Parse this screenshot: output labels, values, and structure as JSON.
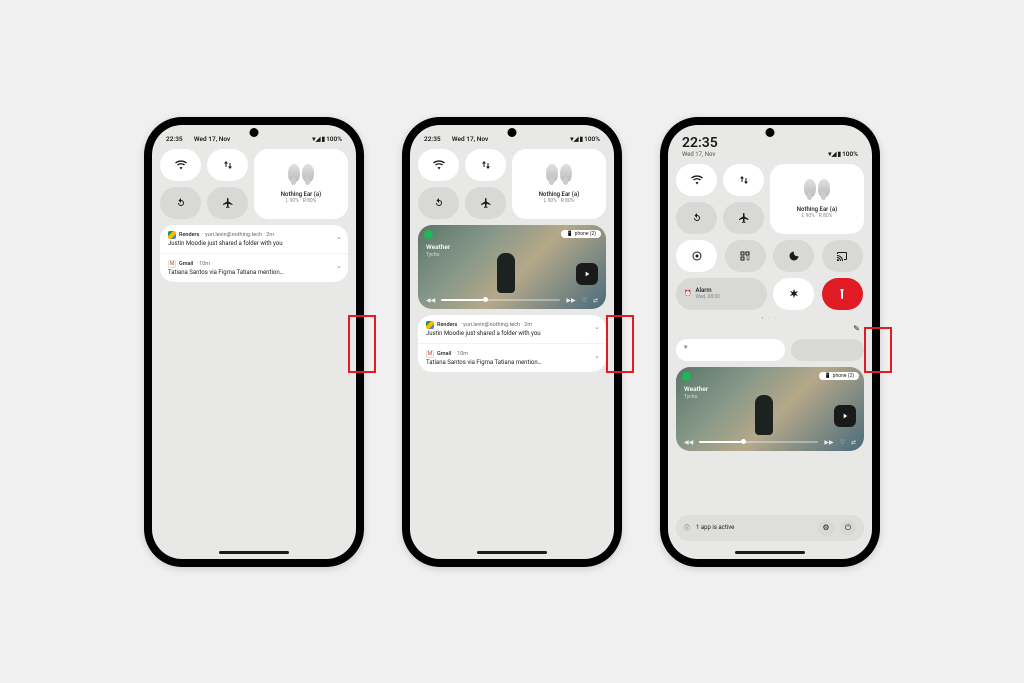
{
  "status": {
    "time": "22:35",
    "date": "Wed 17, Nov",
    "battery": "100%"
  },
  "earbuds": {
    "name": "Nothing Ear (a)",
    "battery": "L 90% · R 80%"
  },
  "media": {
    "tag": "phone (2)",
    "title": "Weather",
    "artist": "Tycho"
  },
  "notifs": {
    "drive": {
      "app": "Renders",
      "meta": "· yuri.levin@nothing.tech · 2m",
      "body": "Justin Moodie just shared a folder with you"
    },
    "gmail": {
      "app": "Gmail",
      "meta": "· 10m",
      "body": "Tatiana Santos via Figma Tatiana mention…"
    }
  },
  "alarm": {
    "label": "Alarm",
    "time": "Wed, 08:00"
  },
  "footer": {
    "text": "1 app is active"
  },
  "dots": "• · ·"
}
